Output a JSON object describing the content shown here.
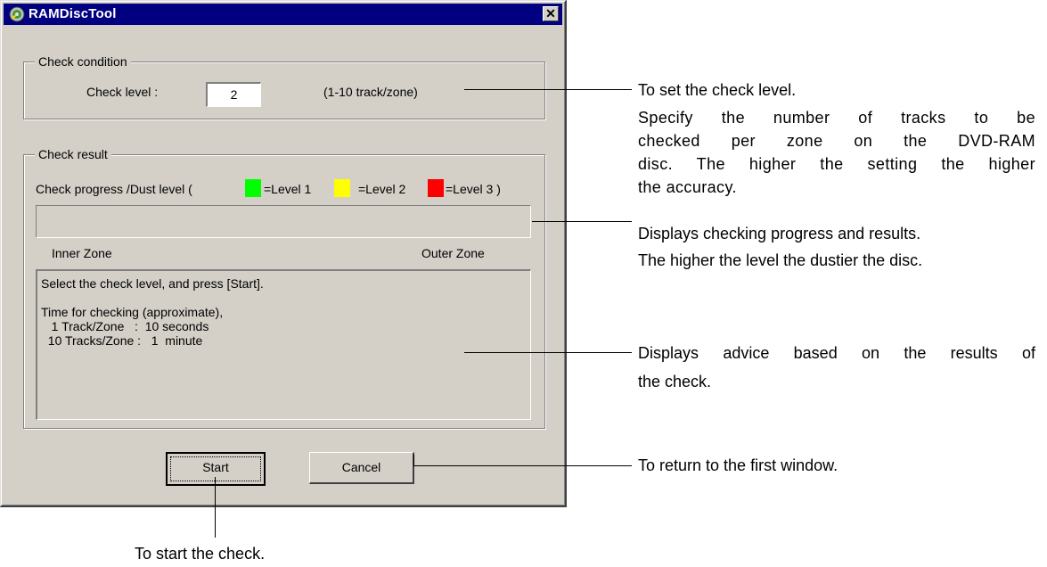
{
  "window": {
    "title": "RAMDiscTool",
    "close_glyph": "✕"
  },
  "condition": {
    "group_title": "Check condition",
    "level_label": "Check level :",
    "level_value": "2",
    "range_text": "(1-10 track/zone)"
  },
  "result": {
    "group_title": "Check result",
    "progress_prefix": "Check progress /Dust level (",
    "level1_label": "=Level 1",
    "level2_label": "=Level 2",
    "level3_label": "=Level 3 )",
    "level1_color": "#00ff00",
    "level2_color": "#ffff00",
    "level3_color": "#ff0000",
    "inner_zone": "Inner Zone",
    "outer_zone": "Outer Zone",
    "advice_lines": [
      "Select the check level, and press [Start].",
      "",
      "Time for checking (approximate),",
      "   1 Track/Zone   :  10 seconds",
      "  10 Tracks/Zone :   1  minute"
    ]
  },
  "buttons": {
    "start": "Start",
    "cancel": "Cancel"
  },
  "annotations": {
    "check_level_title": "To set the check level.",
    "check_level_desc": [
      "Specify the number of tracks to be",
      "checked per zone on the DVD-RAM",
      "disc. The higher the setting the higher",
      "the accuracy."
    ],
    "progress_lines": [
      "Displays checking progress and results.",
      "The higher the level the dustier the disc."
    ],
    "advice_text_lines": [
      "Displays advice based on the results of",
      "the check."
    ],
    "cancel_text": "To return to the first window.",
    "start_text": "To start the check."
  }
}
